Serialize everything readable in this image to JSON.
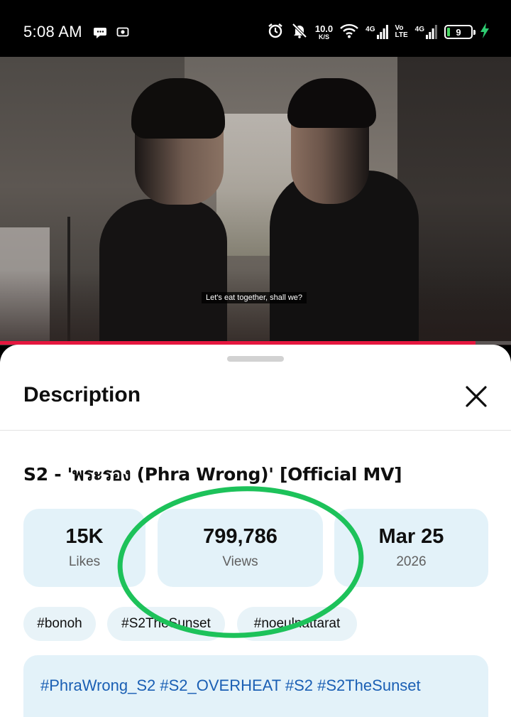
{
  "status_bar": {
    "time": "5:08 AM",
    "net_speed_value": "10.0",
    "net_speed_unit": "K/S",
    "sim1_label": "4G",
    "volte_line1": "Vo",
    "volte_line2": "LTE",
    "sim2_label": "4G",
    "battery_level": "9",
    "icons": [
      "message-icon",
      "screenshot-icon",
      "alarm-icon",
      "muted-bell-icon",
      "wifi-icon",
      "signal-icon",
      "battery-icon",
      "charging-icon"
    ]
  },
  "video": {
    "subtitle": "Let's eat together, shall we?",
    "progress": 0.93,
    "progress_color": "#e5173f"
  },
  "description_sheet": {
    "header_title": "Description",
    "video_title": "S2 - 'พระรอง (Phra Wrong)' [Official MV]",
    "stats": [
      {
        "value": "15K",
        "label": "Likes"
      },
      {
        "value": "799,786",
        "label": "Views"
      },
      {
        "value": "Mar 25",
        "label": "2026"
      }
    ],
    "tags": [
      "#bonoh",
      "#S2TheSunset",
      "#noeulnattarat"
    ],
    "description_hashtags": "#PhraWrong_S2 #S2_OVERHEAT #S2 #S2TheSunset",
    "link_color": "#1a5fb4",
    "annotation_color": "#1dc25a"
  }
}
